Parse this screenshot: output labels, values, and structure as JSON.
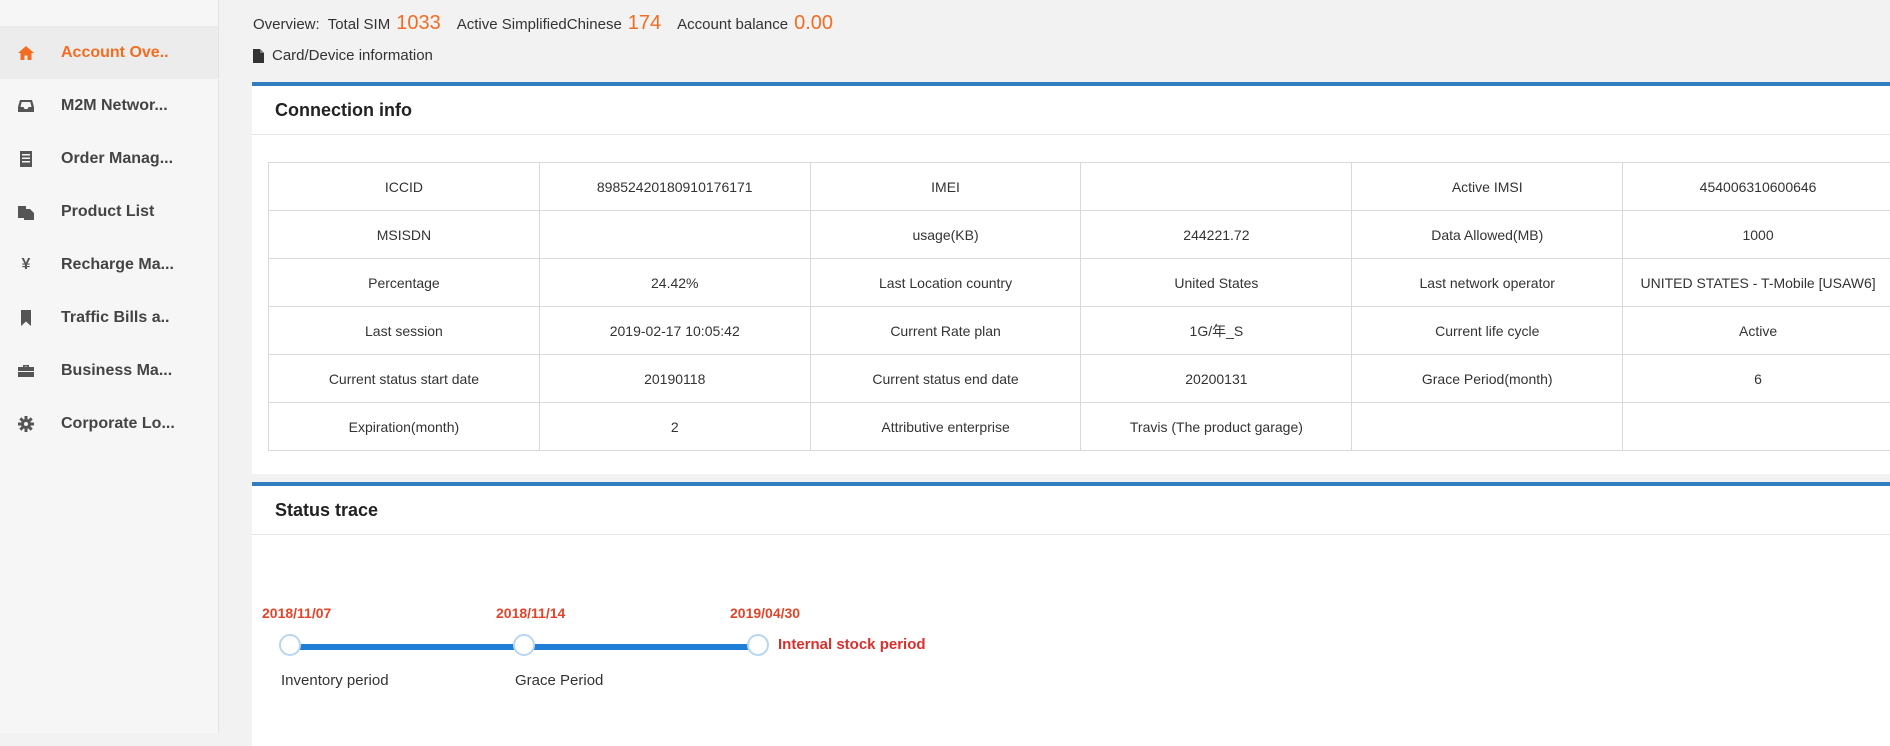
{
  "sidebar": {
    "items": [
      {
        "label": "Account Ove..",
        "icon": "home-icon",
        "active": true
      },
      {
        "label": "M2M Networ...",
        "icon": "inbox-icon"
      },
      {
        "label": "Order Manag...",
        "icon": "document-list-icon"
      },
      {
        "label": "Product List",
        "icon": "copy-icon"
      },
      {
        "label": "Recharge Ma...",
        "icon": "yen-icon"
      },
      {
        "label": "Traffic Bills a..",
        "icon": "bookmark-icon"
      },
      {
        "label": "Business Ma...",
        "icon": "briefcase-icon"
      },
      {
        "label": "Corporate Lo...",
        "icon": "gear-icon"
      }
    ]
  },
  "overview": {
    "prefix": "Overview:",
    "total_sim_label": "Total SIM",
    "total_sim_value": "1033",
    "active_label": "Active SimplifiedChinese",
    "active_value": "174",
    "balance_label": "Account balance",
    "balance_value": "0.00"
  },
  "card_info": {
    "label": "Card/Device information"
  },
  "connection": {
    "title": "Connection info",
    "rows": [
      [
        "ICCID",
        "89852420180910176171",
        "IMEI",
        "",
        "Active IMSI",
        "454006310600646"
      ],
      [
        "MSISDN",
        "",
        "usage(KB)",
        "244221.72",
        "Data Allowed(MB)",
        "1000"
      ],
      [
        "Percentage",
        "24.42%",
        "Last Location country",
        "United States",
        "Last network operator",
        "UNITED STATES - T-Mobile [USAW6]"
      ],
      [
        "Last session",
        "2019-02-17 10:05:42",
        "Current Rate plan",
        "1G/年_S",
        "Current life cycle",
        "Active"
      ],
      [
        "Current status start date",
        "20190118",
        "Current status end date",
        "20200131",
        "Grace Period(month)",
        "6"
      ],
      [
        "Expiration(month)",
        "2",
        "Attributive enterprise",
        "Travis (The product garage)",
        "",
        ""
      ]
    ]
  },
  "status_trace": {
    "title": "Status trace",
    "dates": [
      "2018/11/07",
      "2018/11/14",
      "2019/04/30"
    ],
    "labels": [
      "Inventory period",
      "Grace Period"
    ],
    "current": "Internal stock period",
    "colors": {
      "line": "#1f7fd6",
      "date": "#e1452a",
      "current": "#d9302c"
    }
  },
  "colors": {
    "accent": "#f26d21",
    "panel_border": "#2f7fc0"
  }
}
